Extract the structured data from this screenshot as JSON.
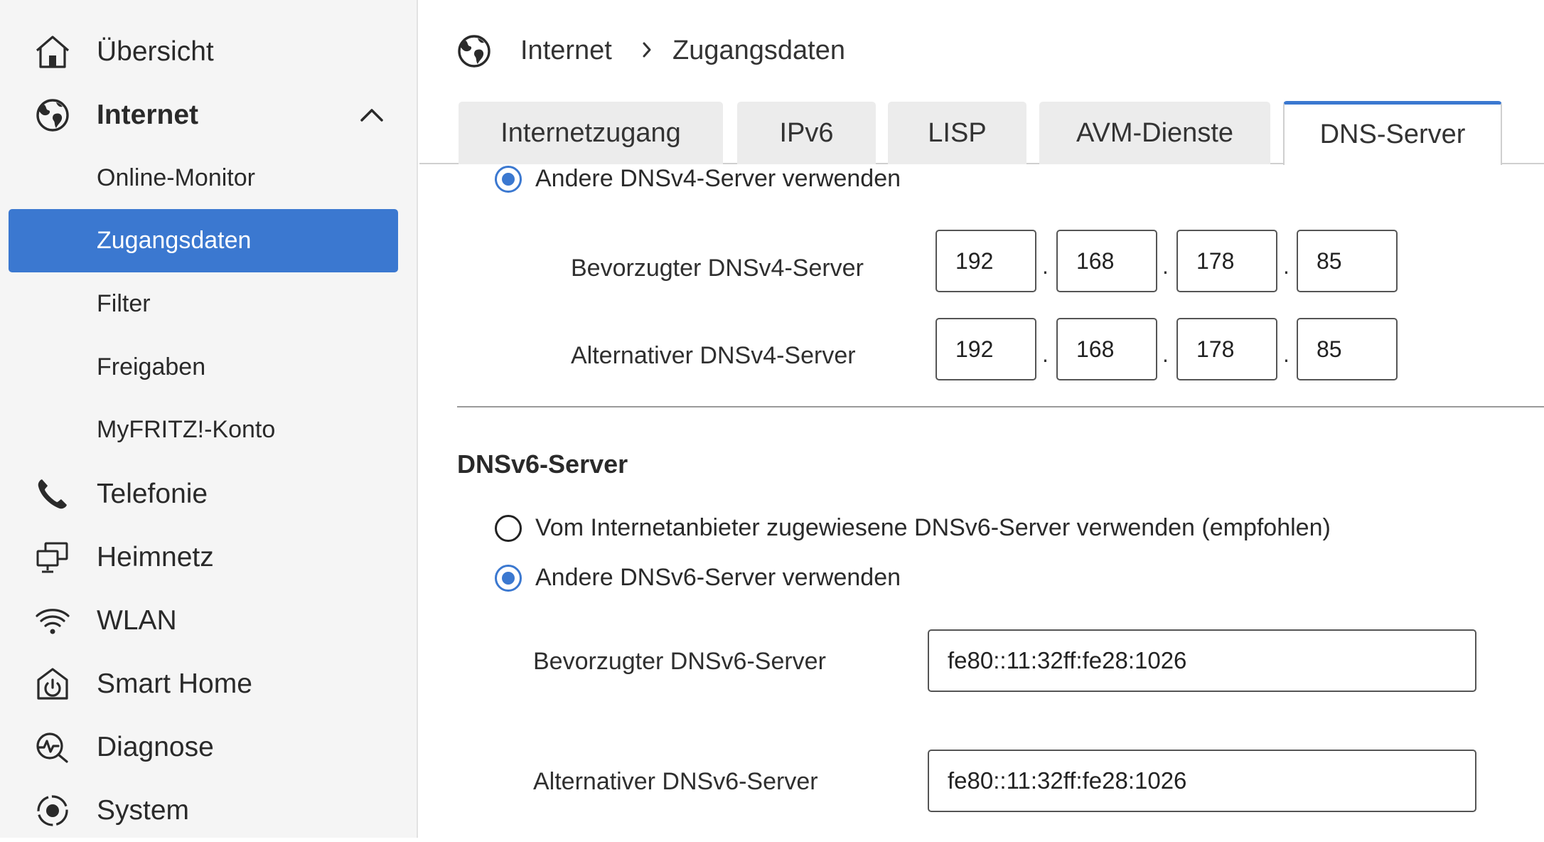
{
  "sidebar": {
    "items": [
      {
        "label": "Übersicht",
        "icon": "home-icon"
      },
      {
        "label": "Internet",
        "icon": "globe-icon",
        "expanded": true
      },
      {
        "label": "Telefonie",
        "icon": "phone-icon"
      },
      {
        "label": "Heimnetz",
        "icon": "network-icon"
      },
      {
        "label": "WLAN",
        "icon": "wifi-icon"
      },
      {
        "label": "Smart Home",
        "icon": "power-icon"
      },
      {
        "label": "Diagnose",
        "icon": "diagnose-icon"
      },
      {
        "label": "System",
        "icon": "system-icon"
      }
    ],
    "sub_items": [
      {
        "label": "Online-Monitor"
      },
      {
        "label": "Zugangsdaten",
        "active": true
      },
      {
        "label": "Filter"
      },
      {
        "label": "Freigaben"
      },
      {
        "label": "MyFRITZ!-Konto"
      }
    ],
    "accent_color": "#3b78d0"
  },
  "breadcrumb": {
    "root": "Internet",
    "current": "Zugangsdaten",
    "icon": "globe-icon"
  },
  "tabs": [
    {
      "label": "Internetzugang"
    },
    {
      "label": "IPv6"
    },
    {
      "label": "LISP"
    },
    {
      "label": "AVM-Dienste"
    },
    {
      "label": "DNS-Server",
      "active": true
    }
  ],
  "dnsv4": {
    "other_option_label": "Andere DNSv4-Server verwenden",
    "other_selected": true,
    "preferred_label": "Bevorzugter DNSv4-Server",
    "preferred": [
      "192",
      "168",
      "178",
      "85"
    ],
    "alternate_label": "Alternativer DNSv4-Server",
    "alternate": [
      "192",
      "168",
      "178",
      "85"
    ]
  },
  "dnsv6": {
    "title": "DNSv6-Server",
    "provider_option_label": "Vom Internetanbieter zugewiesene DNSv6-Server verwenden (empfohlen)",
    "other_option_label": "Andere DNSv6-Server verwenden",
    "other_selected": true,
    "preferred_label": "Bevorzugter DNSv6-Server",
    "preferred": "fe80::11:32ff:fe28:1026",
    "alternate_label": "Alternativer DNSv6-Server",
    "alternate": "fe80::11:32ff:fe28:1026"
  }
}
